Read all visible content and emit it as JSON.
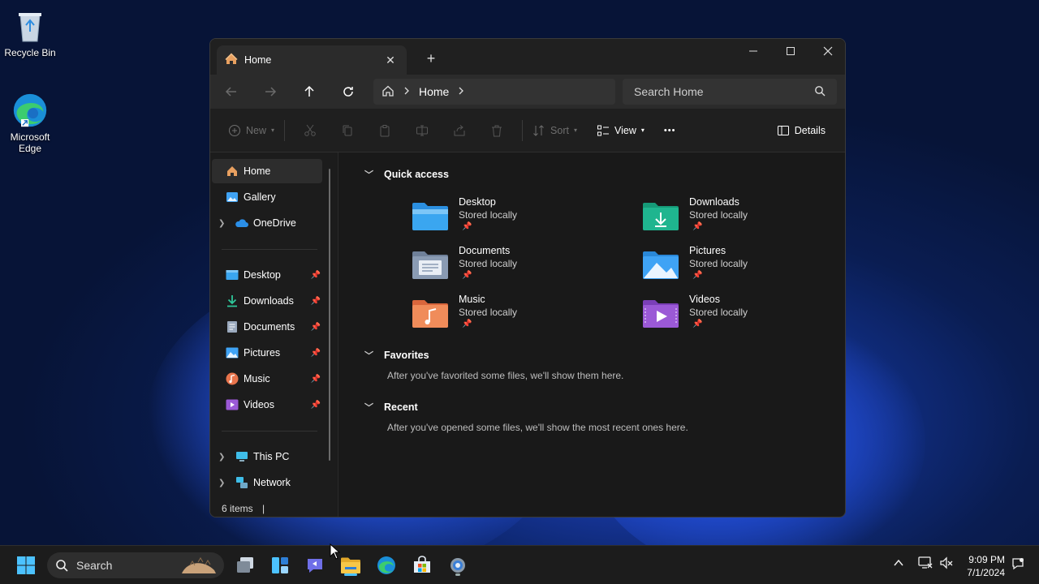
{
  "desktop": {
    "recycle_bin": "Recycle Bin",
    "edge_line1": "Microsoft",
    "edge_line2": "Edge"
  },
  "window": {
    "tab_title": "Home",
    "breadcrumb": "Home",
    "search_placeholder": "Search Home"
  },
  "toolbar": {
    "new_label": "New",
    "sort_label": "Sort",
    "view_label": "View",
    "more_label": "•••",
    "details_label": "Details"
  },
  "sidebar": {
    "home": "Home",
    "gallery": "Gallery",
    "onedrive": "OneDrive",
    "desktop": "Desktop",
    "downloads": "Downloads",
    "documents": "Documents",
    "pictures": "Pictures",
    "music": "Music",
    "videos": "Videos",
    "this_pc": "This PC",
    "network": "Network"
  },
  "status": {
    "items": "6 items"
  },
  "main": {
    "quick_access": {
      "title": "Quick access",
      "items": [
        {
          "name": "Desktop",
          "sub": "Stored locally"
        },
        {
          "name": "Downloads",
          "sub": "Stored locally"
        },
        {
          "name": "Documents",
          "sub": "Stored locally"
        },
        {
          "name": "Pictures",
          "sub": "Stored locally"
        },
        {
          "name": "Music",
          "sub": "Stored locally"
        },
        {
          "name": "Videos",
          "sub": "Stored locally"
        }
      ]
    },
    "favorites": {
      "title": "Favorites",
      "note": "After you've favorited some files, we'll show them here."
    },
    "recent": {
      "title": "Recent",
      "note": "After you've opened some files, we'll show the most recent ones here."
    }
  },
  "taskbar": {
    "search_label": "Search",
    "time": "9:09 PM",
    "date": "7/1/2024"
  },
  "colors": {
    "accent": "#4cc2ff",
    "folder_desktop": "#3aa6f0",
    "folder_downloads": "#1fb58f",
    "folder_documents": "#8a9bb3",
    "folder_pictures": "#3fa3f5",
    "folder_music": "#f08c5a",
    "folder_videos": "#9b59d6"
  }
}
